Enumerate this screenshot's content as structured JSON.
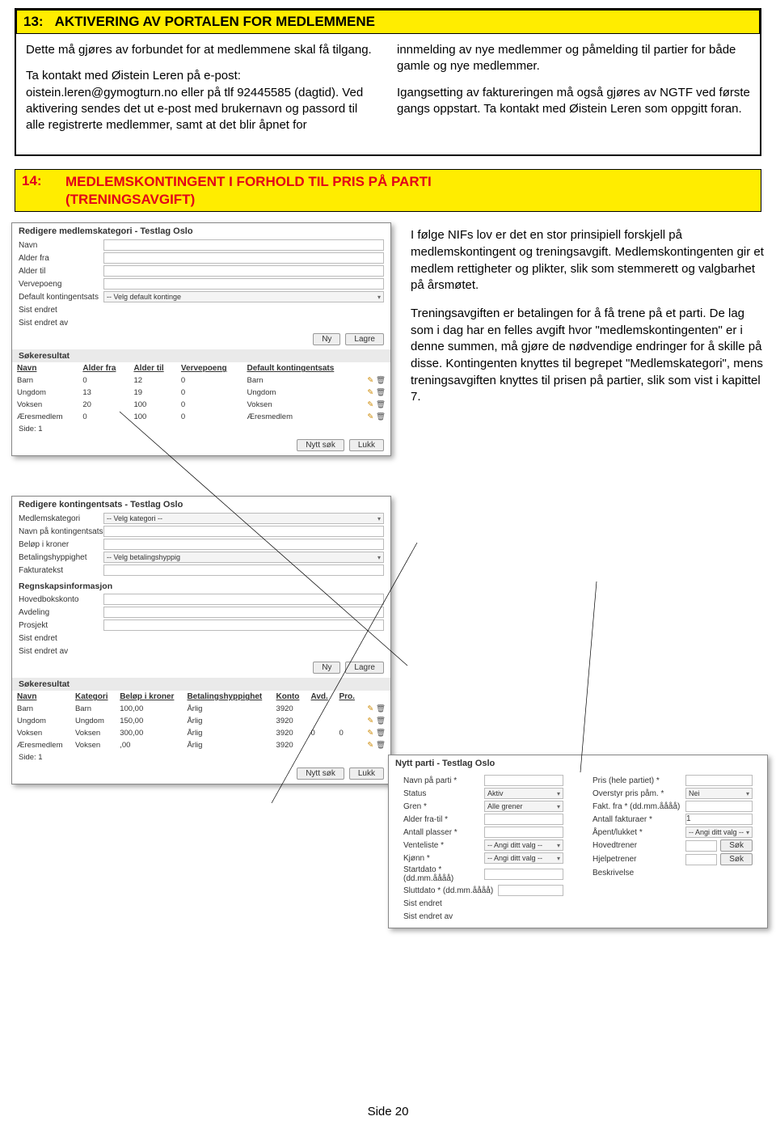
{
  "section13": {
    "num": "13:",
    "title": "AKTIVERING AV PORTALEN FOR MEDLEMMENE",
    "left": "Dette må gjøres av forbundet for at medlemmene skal få tilgang.\n\nTa kontakt med Øistein Leren på e-post: oistein.leren@gymogturn.no eller på tlf 92445585 (dagtid).\nVed aktivering sendes det ut e-post med brukernavn og passord til alle registrerte medlemmer, samt at det blir åpnet for",
    "right": "innmelding av nye medlemmer og påmelding til partier for både gamle og nye medlemmer.\n\nIgangsetting av faktureringen må også gjøres av NGTF ved første gangs oppstart. Ta kontakt med Øistein Leren som oppgitt foran."
  },
  "section14": {
    "num": "14:",
    "title": "MEDLEMSKONTINGENT I FORHOLD TIL PRIS PÅ PARTI (TRENINGSAVGIFT)",
    "p1": "I følge NIFs lov er det en stor prinsipiell forskjell på medlemskontingent og treningsavgift. Medlemskontingenten gir et medlem rettigheter og plikter, slik som stemmerett og valgbarhet på årsmøtet.",
    "p2": "Treningsavgiften er betalingen for å få trene på et parti. De lag som i dag har en felles avgift hvor \"medlemskontingenten\" er i denne summen, må gjøre de nødvendige endringer for å skille på disse. Kontingenten knyttes til begrepet \"Medlemskategori\", mens treningsavgiften knyttes til prisen på partier, slik som vist i kapittel 7."
  },
  "panel1": {
    "title": "Redigere medlemskategori - Testlag Oslo",
    "fields": [
      "Navn",
      "Alder fra",
      "Alder til",
      "Vervepoeng",
      "Default kontingentsats",
      "Sist endret",
      "Sist endret av"
    ],
    "sel_default": "-- Velg default kontinge",
    "btn_ny": "Ny",
    "btn_lagre": "Lagre",
    "search_title": "Søkeresultat",
    "cols": [
      "Navn",
      "Alder fra",
      "Alder til",
      "Vervepoeng",
      "Default kontingentsats"
    ],
    "rows": [
      [
        "Barn",
        "0",
        "12",
        "0",
        "Barn"
      ],
      [
        "Ungdom",
        "13",
        "19",
        "0",
        "Ungdom"
      ],
      [
        "Voksen",
        "20",
        "100",
        "0",
        "Voksen"
      ],
      [
        "Æresmedlem",
        "0",
        "100",
        "0",
        "Æresmedlem"
      ]
    ],
    "side": "Side: 1",
    "btn_nytt": "Nytt søk",
    "btn_lukk": "Lukk"
  },
  "panel2": {
    "title": "Redigere kontingentsats - Testlag Oslo",
    "fields": [
      "Medlemskategori",
      "Navn på kontingentsats",
      "Beløp i kroner",
      "Betalingshyppighet",
      "Fakturatekst"
    ],
    "sel_kat": "-- Velg kategori --",
    "sel_bet": "-- Velg betalingshyppig",
    "regn_title": "Regnskapsinformasjon",
    "regn_fields": [
      "Hovedbokskonto",
      "Avdeling",
      "Prosjekt",
      "Sist endret",
      "Sist endret av"
    ],
    "btn_ny": "Ny",
    "btn_lagre": "Lagre",
    "search_title": "Søkeresultat",
    "cols": [
      "Navn",
      "Kategori",
      "Beløp i kroner",
      "Betalingshyppighet",
      "Konto",
      "Avd.",
      "Pro."
    ],
    "rows": [
      [
        "Barn",
        "Barn",
        "100,00",
        "Årlig",
        "3920",
        "",
        ""
      ],
      [
        "Ungdom",
        "Ungdom",
        "150,00",
        "Årlig",
        "3920",
        "",
        ""
      ],
      [
        "Voksen",
        "Voksen",
        "300,00",
        "Årlig",
        "3920",
        "0",
        "0"
      ],
      [
        "Æresmedlem",
        "Voksen",
        ",00",
        "Årlig",
        "3920",
        "",
        ""
      ]
    ],
    "side": "Side: 1",
    "btn_nytt": "Nytt søk",
    "btn_lukk": "Lukk"
  },
  "panel3": {
    "title": "Nytt parti - Testlag Oslo",
    "left": [
      {
        "l": "Navn på parti *",
        "t": "input"
      },
      {
        "l": "Status",
        "t": "sel",
        "v": "Aktiv"
      },
      {
        "l": "Gren *",
        "t": "sel",
        "v": "Alle grener"
      },
      {
        "l": "Alder fra-til *",
        "t": "input"
      },
      {
        "l": "Antall plasser *",
        "t": "input"
      },
      {
        "l": "Venteliste *",
        "t": "sel",
        "v": "-- Angi ditt valg --"
      },
      {
        "l": "Kjønn *",
        "t": "sel",
        "v": "-- Angi ditt valg --"
      },
      {
        "l": "Startdato * (dd.mm.åååå)",
        "t": "input"
      },
      {
        "l": "",
        "t": "text",
        "v": "Sluttdato * (dd.mm.åååå)"
      },
      {
        "l": "Sist endret",
        "t": "none"
      },
      {
        "l": "Sist endret av",
        "t": "none"
      }
    ],
    "right": [
      {
        "l": "Pris (hele partiet) *",
        "t": "input"
      },
      {
        "l": "Overstyr pris påm. *",
        "t": "sel",
        "v": "Nei"
      },
      {
        "l": "Fakt. fra * (dd.mm.åååå)",
        "t": "input"
      },
      {
        "l": "Antall fakturaer *",
        "t": "input",
        "v": "1"
      },
      {
        "l": "Åpent/lukket *",
        "t": "sel",
        "v": "-- Angi ditt valg --"
      },
      {
        "l": "Hovedtrener",
        "t": "search"
      },
      {
        "l": "Hjelpetrener",
        "t": "search"
      },
      {
        "l": "Beskrivelse",
        "t": "none"
      }
    ],
    "sok": "Søk"
  },
  "footer": "Side 20"
}
